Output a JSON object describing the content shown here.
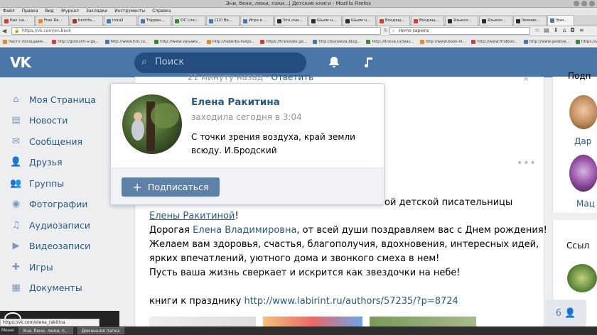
{
  "window": {
    "title": "Эни, бени, люки, паки...| Детские книги - Mozilla Firefox"
  },
  "menu": [
    "Файл",
    "Правка",
    "Вид",
    "Журнал",
    "Закладки",
    "Инструменты",
    "Справка"
  ],
  "tabs": [
    {
      "label": "Как сш...",
      "color": "#c94141"
    },
    {
      "label": "Free Ra...",
      "color": "#e38a2b"
    },
    {
      "label": "birchfa...",
      "color": "#a63232"
    },
    {
      "label": "mirall",
      "color": "#4a76a8"
    },
    {
      "label": "Торрен...",
      "color": "#4a76a8"
    },
    {
      "label": "ОС Linu...",
      "color": "#3b8a3b"
    },
    {
      "label": "(12) Вх...",
      "color": "#4a76a8"
    },
    {
      "label": "Игра в ...",
      "color": "#4a76a8"
    },
    {
      "label": "Что очи...",
      "color": "#2b2b2b"
    },
    {
      "label": "Шьем н...",
      "color": "#2b2b2b"
    },
    {
      "label": "Шьем н...",
      "color": "#2b2b2b"
    },
    {
      "label": "Входящ...",
      "color": "#c94141"
    },
    {
      "label": "Входящ...",
      "color": "#c94141"
    },
    {
      "label": "Языкоз...",
      "color": "#2b2b2b"
    },
    {
      "label": "Языкоз...",
      "color": "#2b2b2b"
    },
    {
      "label": "Челове...",
      "color": "#2b2b2b"
    },
    {
      "label": "Эни...",
      "color": "#4a76a8"
    }
  ],
  "address": {
    "url": "https://vk.com/en.book",
    "search_value": "Homo sapiens"
  },
  "bookmarks": [
    "Часто посещаем...",
    "http://gotovim-v-go...",
    "http://www.hm.co...",
    "http://www.valyaev...",
    "http://taberko.livejo...",
    "https://translate.go...",
    "http://kuneeva.blog...",
    "http://lineva.ru/leav...",
    "http://www.book-ill...",
    "http://www.findboo...",
    "http://www.godove...",
    "https://vk.com/pag..."
  ],
  "header": {
    "logo": "VK",
    "search_placeholder": "Поиск"
  },
  "sidebar": [
    {
      "label": "Моя Страница",
      "icon": "home-icon"
    },
    {
      "label": "Новости",
      "icon": "news-icon"
    },
    {
      "label": "Сообщения",
      "icon": "messages-icon"
    },
    {
      "label": "Друзья",
      "icon": "friends-icon"
    },
    {
      "label": "Группы",
      "icon": "groups-icon"
    },
    {
      "label": "Фотографии",
      "icon": "camera-icon"
    },
    {
      "label": "Аудиозаписи",
      "icon": "music-icon"
    },
    {
      "label": "Видеозаписи",
      "icon": "video-icon"
    },
    {
      "label": "Игры",
      "icon": "gamepad-icon"
    },
    {
      "label": "Документы",
      "icon": "document-icon"
    }
  ],
  "post_top": {
    "time": "21 минуту назад",
    "reply": "Ответить"
  },
  "popup": {
    "name": "Елена Ракитина",
    "last_seen": "заходила сегодня в 3:04",
    "status_line1": "С точки зрения воздуха, край земли",
    "status_line2": "всюду. И.Бродский",
    "subscribe_label": "Подписаться"
  },
  "post": {
    "line1_tail": "ой детской писательницы",
    "line2_link": "Елены Ракитиной",
    "line2_end": "!",
    "line3_a": "Дорогая ",
    "line3_link": "Елена Владимировна",
    "line3_b": ", от всей души поздравляем вас с Днем рождения!",
    "line4": "Желаем вам здоровья, счастья, благополучия, вдохновения, интересных идей,",
    "line5": "ярких впечатлений, уютного дома и звонкого смеха в нем!",
    "line6": "Пусть ваша жизнь сверкает и искрится как звездочки на небе!",
    "line7_a": "книги к празднику ",
    "line7_link": "http://www.labirint.ru/authors/57235/?p=8724"
  },
  "right": {
    "title": "Подп",
    "friend1": "Дар",
    "friend2": "Мац",
    "links_title": "Ссыл",
    "counter": "6"
  },
  "status_url": "https://vk.com/elena_rakitina",
  "taskbar": [
    "Меню",
    "Эни, бени, люки, п...",
    "Домашняя папка"
  ]
}
